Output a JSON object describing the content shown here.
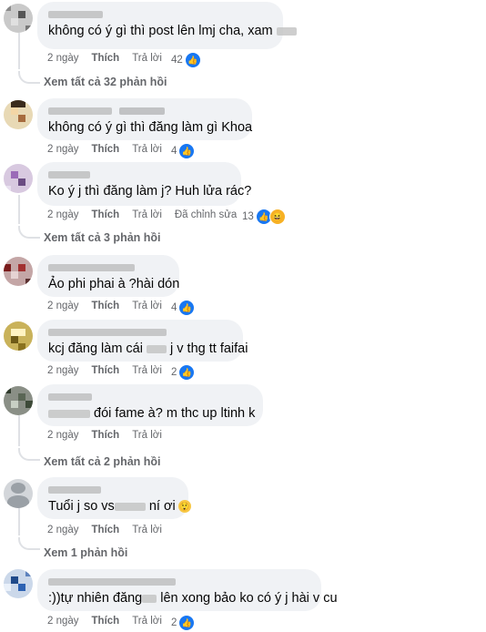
{
  "actions": {
    "like": "Thích",
    "reply": "Trả lời",
    "edited": "Đã chỉnh sửa"
  },
  "comments": [
    {
      "text": "không có ý gì thì post lên lmj cha, xam",
      "time": "2 ngày",
      "reactions": "42",
      "view_replies": "Xem tất cả 32 phản hồi"
    },
    {
      "text": "không có ý gì thì đăng làm   gì Khoa",
      "time": "2 ngày",
      "reactions": "4"
    },
    {
      "text": "Ko ý j thì đăng làm j? Huh lửa rác?",
      "time": "2 ngày",
      "reactions": "13",
      "view_replies": "Xem tất cả 3 phản hồi"
    },
    {
      "text": "Ảo phi phai à ?hài dón",
      "time": "2 ngày",
      "reactions": "4"
    },
    {
      "text_a": "kcj đăng làm cái",
      "text_b": "j v thg tt faifai",
      "time": "2 ngày",
      "reactions": "2"
    },
    {
      "text": "đói fame à? m thc up ltinh k",
      "time": "2 ngày",
      "view_replies": "Xem tất cả 2 phản hồi"
    },
    {
      "text_a": "Tuổi j so vs",
      "text_b": "ní ơi",
      "time": "2 ngày",
      "view_replies": "Xem 1 phản hồi"
    },
    {
      "text_a": ":))tự nhiên đăng",
      "text_b": "lên xong bảo ko có ý j hài v cu",
      "time": "2 ngày",
      "reactions": "2"
    }
  ],
  "icons": {
    "like": "like-icon",
    "haha": "haha-icon",
    "emoji": "shocked-emoji-icon"
  },
  "colors": {
    "bubble": "#f0f2f5",
    "meta": "#65676b",
    "like": "#1877f2",
    "thread": "#dfe1e5"
  }
}
